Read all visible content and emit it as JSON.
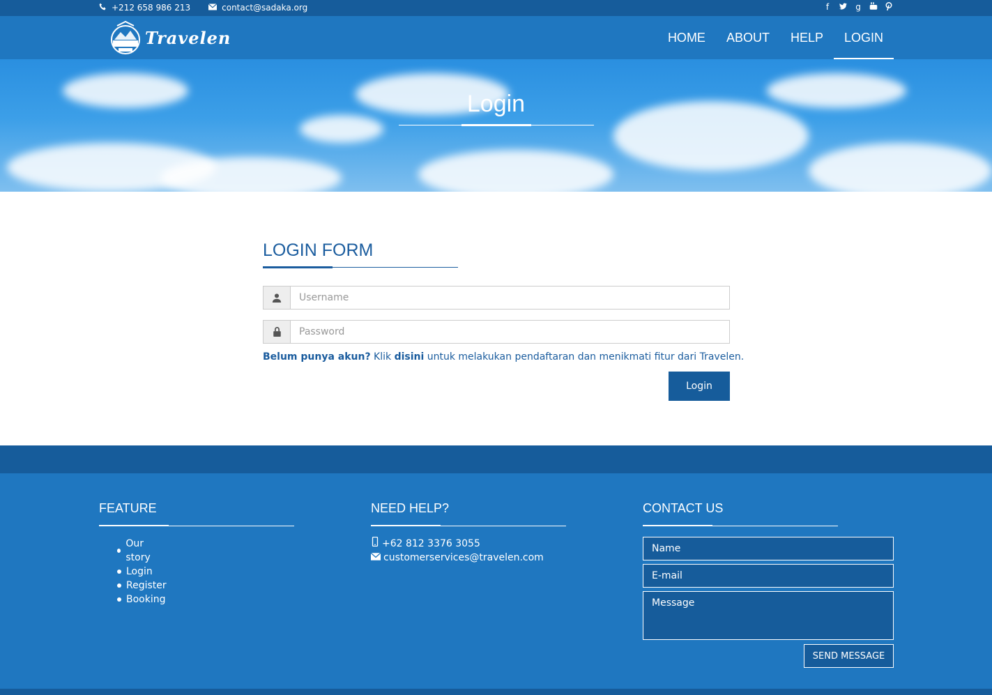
{
  "topbar": {
    "phone": "+212 658 986 213",
    "email": "contact@sadaka.org",
    "social_icons": [
      "facebook-icon",
      "twitter-icon",
      "google-plus-icon",
      "youtube-icon",
      "pinterest-icon"
    ]
  },
  "header": {
    "logo_text": "Travelen",
    "nav": [
      {
        "label": "HOME"
      },
      {
        "label": "ABOUT"
      },
      {
        "label": "HELP"
      },
      {
        "label": "LOGIN",
        "active": true
      }
    ]
  },
  "hero": {
    "title": "Login"
  },
  "login_form": {
    "title": "LOGIN FORM",
    "username_placeholder": "Username",
    "password_placeholder": "Password",
    "register_bold": "Belum punya akun?",
    "register_klik": " Klik ",
    "register_link": "disini",
    "register_rest": " untuk melakukan pendaftaran dan menikmati fitur dari Travelen.",
    "submit_label": "Login"
  },
  "footer": {
    "feature": {
      "title": "FEATURE",
      "items": [
        "Our story",
        "Login",
        "Register",
        "Booking"
      ]
    },
    "help": {
      "title": "NEED HELP?",
      "phone": "+62 812 3376 3055",
      "email": "customerservices@travelen.com"
    },
    "contact": {
      "title": "CONTACT US",
      "name_placeholder": "Name",
      "email_placeholder": "E-mail",
      "message_placeholder": "Message",
      "send_label": "SEND MESSAGE"
    }
  },
  "colors": {
    "primary_dark": "#165c9b",
    "primary": "#1f77c0",
    "text_blue": "#1a5c9e"
  }
}
